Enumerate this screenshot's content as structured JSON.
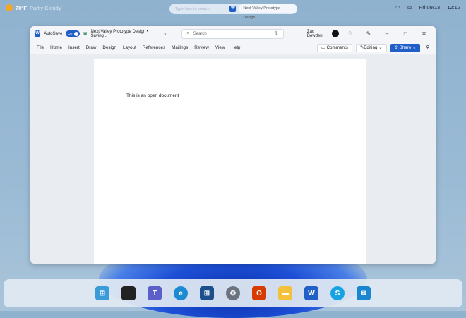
{
  "desktop": {
    "weather_temp": "70°F",
    "weather_cond": "Partly Cloudy",
    "search_placeholder": "Type here to search",
    "active_doc": "Next Valley Prototype Design",
    "date": "Fri 09/13",
    "time": "12:12"
  },
  "word": {
    "autosave": "AutoSave",
    "toggle": "On",
    "doc_title": "Next Valley Prototype Design • Saving...",
    "search": "Search",
    "user": "Zac Bowden",
    "menu": [
      "File",
      "Home",
      "Insert",
      "Draw",
      "Design",
      "Layout",
      "References",
      "Mailings",
      "Review",
      "View",
      "Help"
    ],
    "comments": "Comments",
    "editing": "Editing",
    "share": "Share",
    "body_text": "This is an open document"
  },
  "taskbar": [
    {
      "name": "start",
      "color": "#3a9bd9"
    },
    {
      "name": "terminal",
      "color": "#222222"
    },
    {
      "name": "teams",
      "color": "#5b5fc7"
    },
    {
      "name": "edge",
      "color": "#1a8bd0"
    },
    {
      "name": "store",
      "color": "#1d4f8c"
    },
    {
      "name": "settings",
      "color": "#6b7280"
    },
    {
      "name": "office",
      "color": "#d83b01"
    },
    {
      "name": "file-explorer",
      "color": "#f4c23a"
    },
    {
      "name": "word",
      "color": "#1f5fc7"
    },
    {
      "name": "skype",
      "color": "#17a3e3"
    },
    {
      "name": "mail",
      "color": "#1a86d0"
    }
  ]
}
